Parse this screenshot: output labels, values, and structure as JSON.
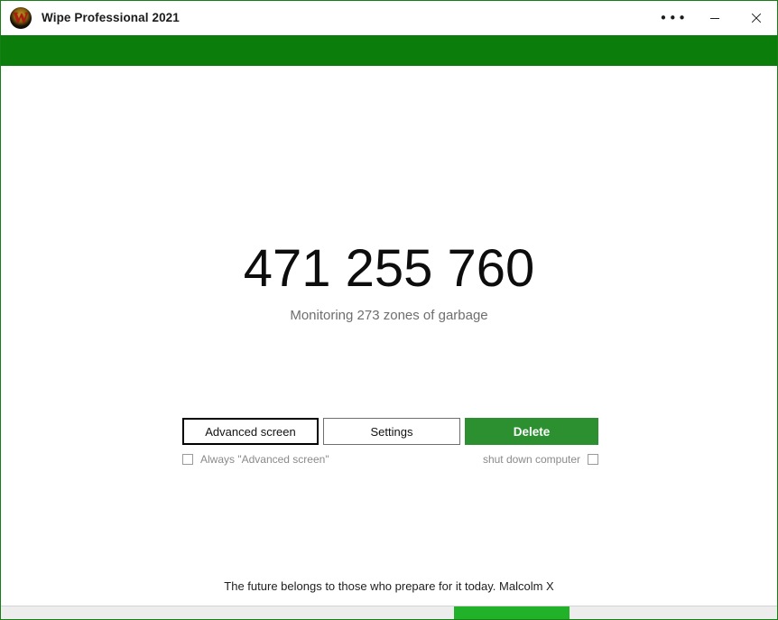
{
  "window": {
    "title": "Wipe Professional 2021",
    "app_icon": "wipe-w-logo-icon",
    "accent_green": "#0b7d0b",
    "delete_green": "#2c9030",
    "progress_green": "#22b22a",
    "border_green": "#167f16"
  },
  "titlebar_buttons": {
    "more": "•••",
    "more_name": "more-options-icon",
    "minimize": "minimize-icon",
    "close": "close-icon"
  },
  "main": {
    "counter": "471 255 760",
    "subcaption": "Monitoring 273 zones of garbage"
  },
  "buttons": {
    "advanced": "Advanced screen",
    "settings": "Settings",
    "delete": "Delete"
  },
  "checkboxes": {
    "always_advanced": {
      "label": "Always \"Advanced screen\"",
      "checked": false
    },
    "shut_down": {
      "label": "shut down computer",
      "checked": false
    }
  },
  "footer": {
    "quote": "The future belongs to those who prepare for it today. Malcolm X"
  },
  "progress": {
    "value_percent": 15,
    "offset_percent": 58
  }
}
